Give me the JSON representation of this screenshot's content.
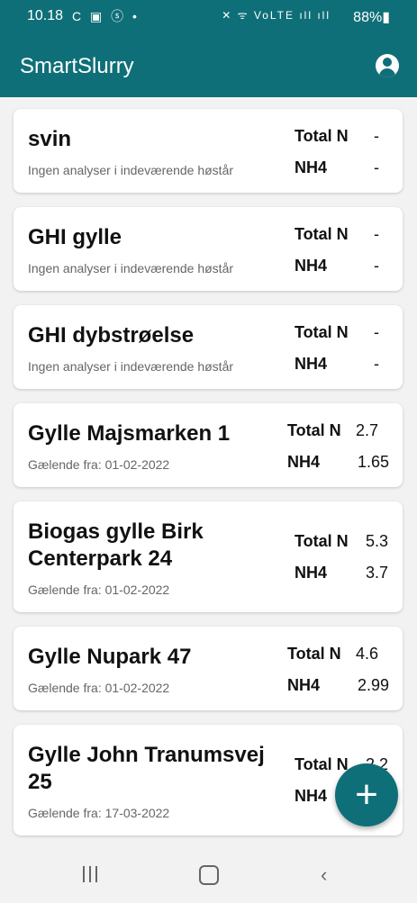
{
  "status": {
    "time": "10.18",
    "left_icons": "C ▣ ⓢ •",
    "right_icons": "✕ ᯤ VoLTE ıll ıll",
    "battery": "88%▮"
  },
  "app": {
    "title": "SmartSlurry",
    "account_icon": "account-circle-icon"
  },
  "labels": {
    "total_n": "Total N",
    "nh4": "NH4"
  },
  "cards": [
    {
      "name": "svin",
      "sub": "Ingen analyser i indeværende høstår",
      "total_n": "-",
      "nh4": "-"
    },
    {
      "name": "GHI gylle",
      "sub": "Ingen analyser i indeværende høstår",
      "total_n": "-",
      "nh4": "-"
    },
    {
      "name": "GHI dybstrøelse",
      "sub": "Ingen analyser i indeværende høstår",
      "total_n": "-",
      "nh4": "-"
    },
    {
      "name": "Gylle Majsmarken 1",
      "sub": "Gælende fra: 01-02-2022",
      "total_n": "2.7",
      "nh4": "1.65"
    },
    {
      "name_line1": "Biogas gylle Birk",
      "name_line2": "Centerpark 24",
      "sub": "Gælende fra: 01-02-2022",
      "total_n": "5.3",
      "nh4": "3.7"
    },
    {
      "name": "Gylle Nupark 47",
      "sub": "Gælende fra: 01-02-2022",
      "total_n": "4.6",
      "nh4": "2.99"
    },
    {
      "name_line1": "Gylle John Tranumsvej",
      "name_line2": "25",
      "sub": "Gælende fra: 17-03-2022",
      "total_n": "2.2",
      "nh4": ""
    }
  ],
  "fab": {
    "label": "+",
    "icon": "add-icon"
  },
  "nav": {
    "recent": "recent-apps-icon",
    "home": "home-icon",
    "back": "‹"
  }
}
